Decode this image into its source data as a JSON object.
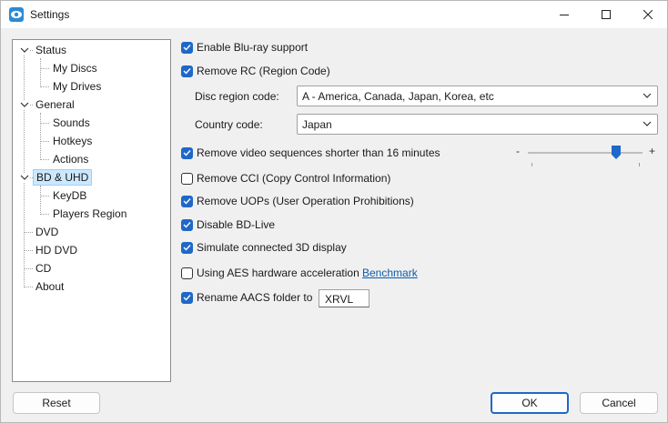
{
  "window": {
    "title": "Settings"
  },
  "tree": {
    "items": [
      {
        "label": "Status"
      },
      {
        "label": "My Discs"
      },
      {
        "label": "My Drives"
      },
      {
        "label": "General"
      },
      {
        "label": "Sounds"
      },
      {
        "label": "Hotkeys"
      },
      {
        "label": "Actions"
      },
      {
        "label": "BD & UHD"
      },
      {
        "label": "KeyDB"
      },
      {
        "label": "Players Region"
      },
      {
        "label": "DVD"
      },
      {
        "label": "HD DVD"
      },
      {
        "label": "CD"
      },
      {
        "label": "About"
      }
    ],
    "selected": "BD & UHD"
  },
  "options": {
    "enable_bluray": {
      "label": "Enable Blu-ray support",
      "checked": true
    },
    "remove_rc": {
      "label": "Remove RC (Region Code)",
      "checked": true
    },
    "disc_region": {
      "label": "Disc region code:",
      "value": "A - America, Canada, Japan, Korea, etc"
    },
    "country": {
      "label": "Country code:",
      "value": "Japan"
    },
    "remove_short": {
      "label": "Remove video sequences shorter than 16 minutes",
      "checked": true
    },
    "slider": {
      "minus": "-",
      "plus": "+",
      "value_fraction": 0.78
    },
    "remove_cci": {
      "label": "Remove CCI (Copy Control Information)",
      "checked": false
    },
    "remove_uops": {
      "label": "Remove UOPs (User Operation Prohibitions)",
      "checked": true
    },
    "disable_bdlive": {
      "label": "Disable BD-Live",
      "checked": true
    },
    "simulate_3d": {
      "label": "Simulate connected 3D display",
      "checked": true
    },
    "aes": {
      "label": "Using AES hardware acceleration",
      "checked": false,
      "link": "Benchmark"
    },
    "rename_aacs": {
      "label": "Rename AACS folder to",
      "checked": true,
      "value": "XRVL"
    }
  },
  "buttons": {
    "reset": "Reset",
    "ok": "OK",
    "cancel": "Cancel"
  },
  "colors": {
    "accent": "#1f68c8",
    "selection": "#cce8ff",
    "link": "#0b5cad"
  }
}
